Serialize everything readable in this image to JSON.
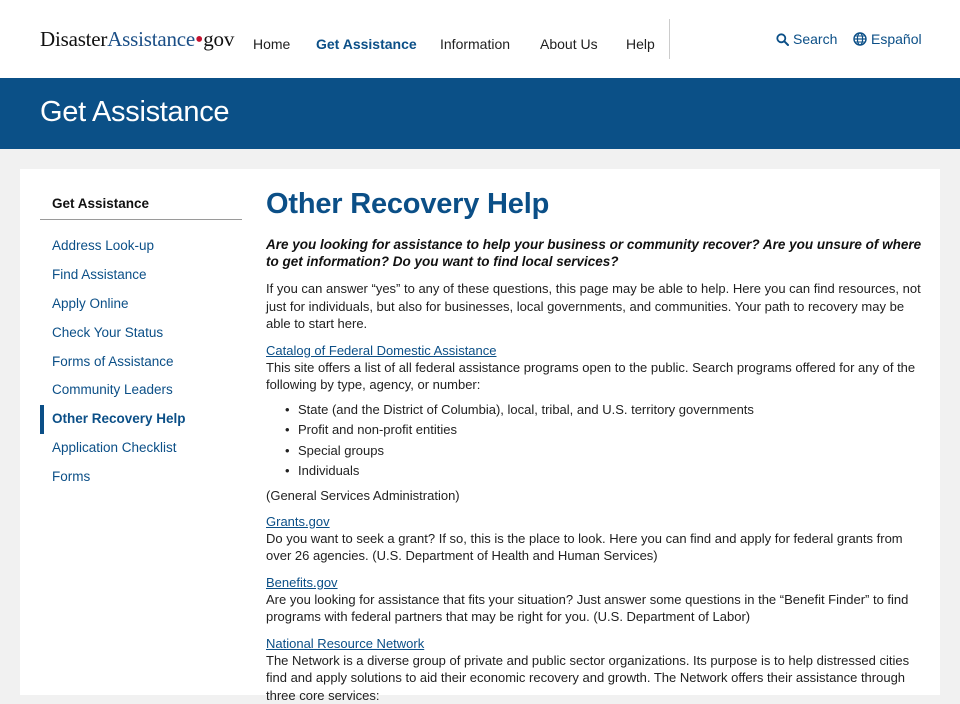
{
  "header": {
    "logo": {
      "part1": "Disaster",
      "part2": "Assistance",
      "dot": "•",
      "part3": "gov"
    },
    "nav": [
      {
        "label": "Home"
      },
      {
        "label": "Get Assistance"
      },
      {
        "label": "Information"
      },
      {
        "label": "About Us"
      },
      {
        "label": "Help"
      }
    ],
    "search_label": "Search",
    "search_icon": "magnifier-icon",
    "language_label": "Español",
    "language_icon": "globe-icon"
  },
  "banner": {
    "title": "Get Assistance"
  },
  "sidebar": {
    "title": "Get Assistance",
    "items": [
      {
        "label": "Address Look-up"
      },
      {
        "label": "Find Assistance"
      },
      {
        "label": "Apply Online"
      },
      {
        "label": "Check Your Status"
      },
      {
        "label": "Forms of Assistance"
      },
      {
        "label": "Community Leaders"
      },
      {
        "label": "Other Recovery Help"
      },
      {
        "label": "Application Checklist"
      },
      {
        "label": "Forms"
      }
    ]
  },
  "main": {
    "title": "Other Recovery Help",
    "intro": "Are you looking for assistance to help your business or community recover? Are you unsure of where to get information? Do you want to find local services?",
    "body": "If you can answer “yes” to any of these questions, this page may be able to help. Here you can find resources, not just for individuals, but also for businesses, local governments, and communities. Your path to recovery may be able to start here.",
    "resources": [
      {
        "link": "Catalog of Federal Domestic Assistance",
        "desc": "This site offers a list of all federal assistance programs open to the public. Search programs offered for any of the following by type, agency, or number:",
        "bullets": [
          "State (and the District of Columbia), local, tribal, and U.S. territory governments",
          "Profit and non-profit entities",
          "Special groups",
          "Individuals"
        ],
        "note": "(General Services Administration)"
      },
      {
        "link": "Grants.gov",
        "desc": "Do you want to seek a grant? If so, this is the place to look. Here you can find and apply for federal grants from over 26 agencies. (U.S. Department of Health and Human Services)"
      },
      {
        "link": "Benefits.gov",
        "desc": "Are you looking for assistance that fits your situation? Just answer some questions in the “Benefit Finder” to find programs with federal partners that may be right for you. (U.S. Department of Labor)"
      },
      {
        "link": "National Resource Network",
        "desc": "The Network is a diverse group of private and public sector organizations. Its purpose is to help distressed cities find and apply solutions to aid their economic recovery and growth. The Network offers their assistance through three core services:"
      }
    ]
  },
  "colors": {
    "brand_blue": "#0b5087",
    "link_blue": "#0b4f87",
    "logo_red": "#c4122f",
    "page_bg": "#f1f1f1"
  }
}
